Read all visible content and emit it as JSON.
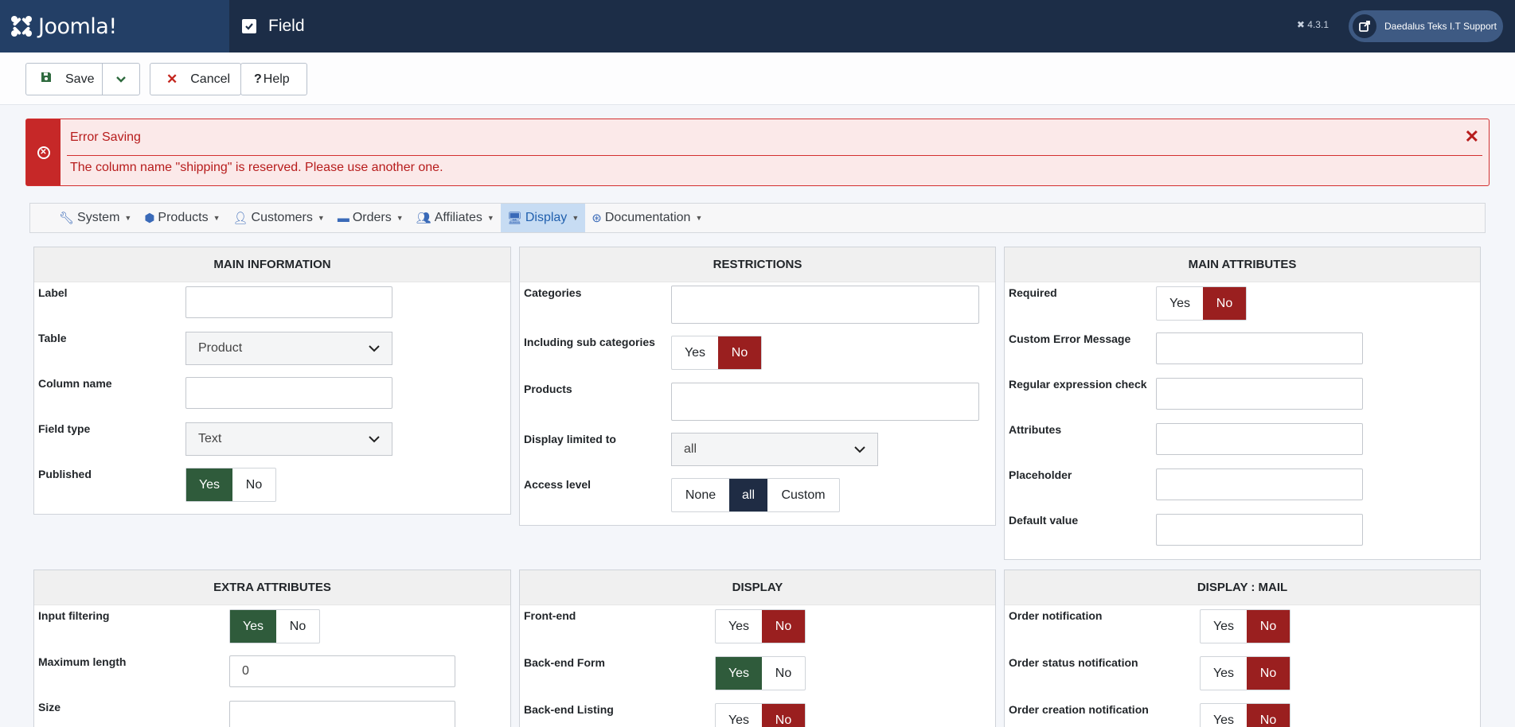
{
  "header": {
    "brand": "Joomla!",
    "title": "Field",
    "version": "4.3.1",
    "user": "Daedalus Teks I.T Support"
  },
  "toolbar": {
    "save": "Save",
    "cancel": "Cancel",
    "help": "Help"
  },
  "alert": {
    "heading": "Error Saving",
    "message": "The column name \"shipping\" is reserved. Please use another one."
  },
  "menu": [
    {
      "label": "System",
      "icon": "wrench-icon"
    },
    {
      "label": "Products",
      "icon": "cubes-icon"
    },
    {
      "label": "Customers",
      "icon": "user-icon"
    },
    {
      "label": "Orders",
      "icon": "credit-card-icon"
    },
    {
      "label": "Affiliates",
      "icon": "users-icon"
    },
    {
      "label": "Display",
      "icon": "desktop-icon"
    },
    {
      "label": "Documentation",
      "icon": "life-ring-icon"
    }
  ],
  "panels": {
    "main_info": {
      "title": "MAIN INFORMATION",
      "label": "Label",
      "table": "Table",
      "table_value": "Product",
      "column_name": "Column name",
      "field_type": "Field type",
      "field_type_value": "Text",
      "published": "Published"
    },
    "restrictions": {
      "title": "RESTRICTIONS",
      "categories": "Categories",
      "including_sub": "Including sub categories",
      "products": "Products",
      "display_limited": "Display limited to",
      "display_limited_value": "all",
      "access_level": "Access level",
      "access_none": "None",
      "access_all": "all",
      "access_custom": "Custom"
    },
    "main_attributes": {
      "title": "MAIN ATTRIBUTES",
      "required": "Required",
      "custom_error": "Custom Error Message",
      "regex": "Regular expression check",
      "attributes": "Attributes",
      "placeholder": "Placeholder",
      "default_value": "Default value"
    },
    "extra_attributes": {
      "title": "EXTRA ATTRIBUTES",
      "input_filtering": "Input filtering",
      "max_length": "Maximum length",
      "max_length_value": "0",
      "size": "Size"
    },
    "display": {
      "title": "DISPLAY",
      "front_end": "Front-end",
      "backend_form": "Back-end Form",
      "backend_listing": "Back-end Listing"
    },
    "display_mail": {
      "title": "DISPLAY : MAIL",
      "order_notification": "Order notification",
      "order_status": "Order status notification",
      "order_creation": "Order creation notification"
    }
  },
  "yes": "Yes",
  "no": "No",
  "colors": {
    "header_bg": "#1c2d47",
    "yes_active": "#2f5b3b",
    "no_active": "#9a1f1f",
    "error": "#c62828"
  }
}
